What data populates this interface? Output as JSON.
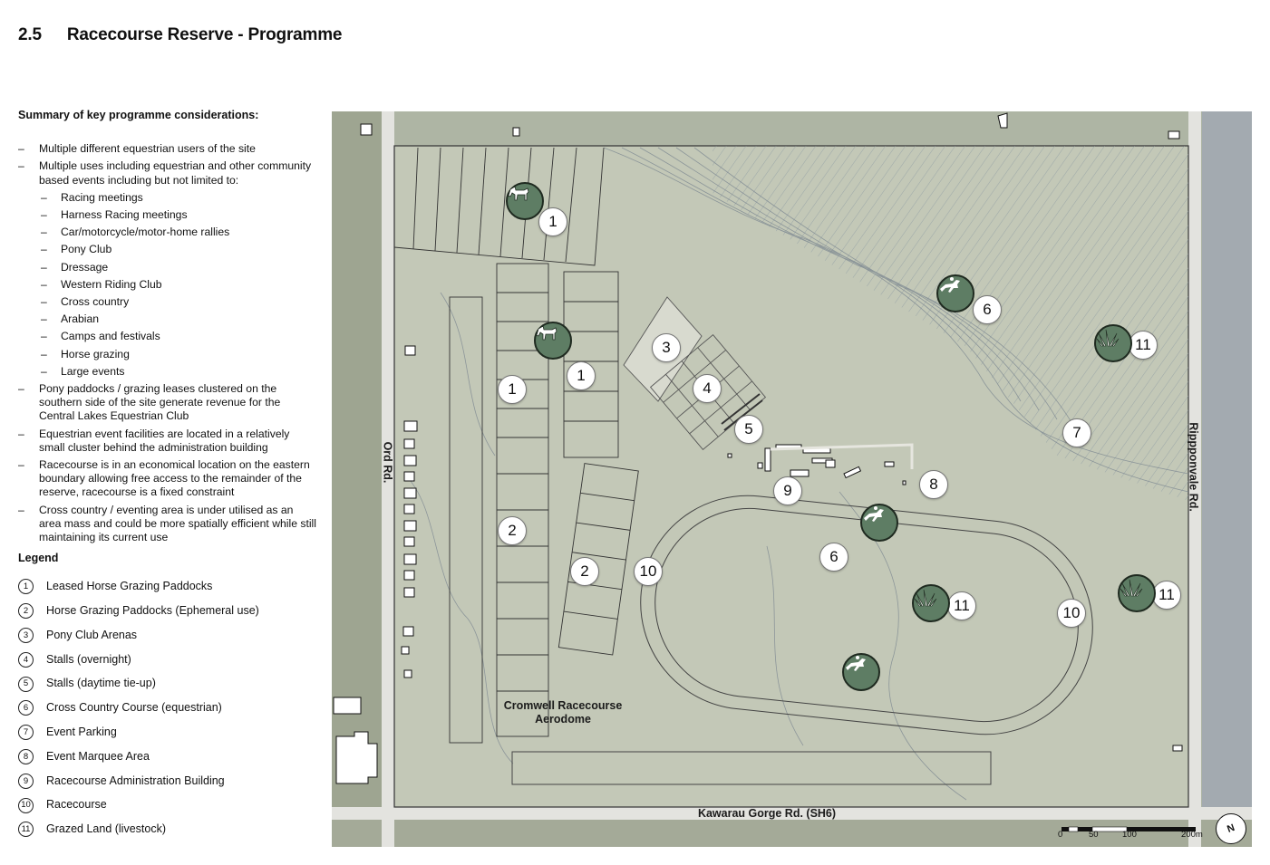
{
  "header": {
    "number": "2.5",
    "title": "Racecourse Reserve - Programme"
  },
  "summary": {
    "heading": "Summary of key programme considerations:",
    "items": [
      {
        "text": "Multiple different equestrian users of the site",
        "level": 1
      },
      {
        "text": "Multiple uses including equestrian and other community based events including but not limited to:",
        "level": 1
      },
      {
        "text": "Racing meetings",
        "level": 2
      },
      {
        "text": "Harness Racing meetings",
        "level": 2
      },
      {
        "text": "Car/motorcycle/motor-home rallies",
        "level": 2
      },
      {
        "text": "Pony Club",
        "level": 2
      },
      {
        "text": "Dressage",
        "level": 2
      },
      {
        "text": "Western Riding Club",
        "level": 2
      },
      {
        "text": "Cross country",
        "level": 2
      },
      {
        "text": "Arabian",
        "level": 2
      },
      {
        "text": "Camps and festivals",
        "level": 2
      },
      {
        "text": "Horse grazing",
        "level": 2
      },
      {
        "text": "Large events",
        "level": 2
      },
      {
        "text": "Pony paddocks / grazing leases clustered on the southern side of the site generate revenue for the Central Lakes Equestrian Club",
        "level": 1
      },
      {
        "text": "Equestrian event facilities are located in a relatively small cluster behind the administration building",
        "level": 1
      },
      {
        "text": "Racecourse is in an economical location on the eastern boundary allowing free access to the remainder of the reserve, racecourse is a fixed constraint",
        "level": 1
      },
      {
        "text": "Cross country / eventing area is under utilised as an area mass and could be more spatially efficient while still maintaining its current use",
        "level": 1
      }
    ]
  },
  "legend": {
    "title": "Legend",
    "items": [
      {
        "num": "1",
        "label": "Leased Horse Grazing Paddocks"
      },
      {
        "num": "2",
        "label": "Horse Grazing Paddocks (Ephemeral use)"
      },
      {
        "num": "3",
        "label": "Pony Club Arenas"
      },
      {
        "num": "4",
        "label": "Stalls (overnight)"
      },
      {
        "num": "5",
        "label": "Stalls (daytime tie-up)"
      },
      {
        "num": "6",
        "label": "Cross Country Course (equestrian)"
      },
      {
        "num": "7",
        "label": "Event Parking"
      },
      {
        "num": "8",
        "label": "Event Marquee Area"
      },
      {
        "num": "9",
        "label": "Racecourse Administration Building"
      },
      {
        "num": "10",
        "label": "Racecourse"
      },
      {
        "num": "11",
        "label": "Grazed Land (livestock)"
      }
    ]
  },
  "map": {
    "roads": {
      "ord": "Ord Rd.",
      "rippon": "Rippponvale Rd.",
      "kawarau": "Kawarau Gorge Rd. (SH6)"
    },
    "aerodrome_line1": "Cromwell Racecourse",
    "aerodrome_line2": "Aerodome",
    "markers": [
      "1",
      "1",
      "1",
      "2",
      "2",
      "3",
      "4",
      "5",
      "6",
      "6",
      "7",
      "8",
      "9",
      "10",
      "10",
      "11",
      "11",
      "11"
    ],
    "icons": {
      "horse": "horse-grazing-icon",
      "rider": "jumping-rider-icon",
      "grass": "grass-icon"
    },
    "scale": {
      "t0": "0",
      "t50": "50",
      "t100": "100",
      "t200": "200m"
    },
    "north": "N",
    "colors": {
      "icon_fill": "#5e7d64",
      "land": "#b9c0ae",
      "road": "#e3e3df"
    }
  }
}
